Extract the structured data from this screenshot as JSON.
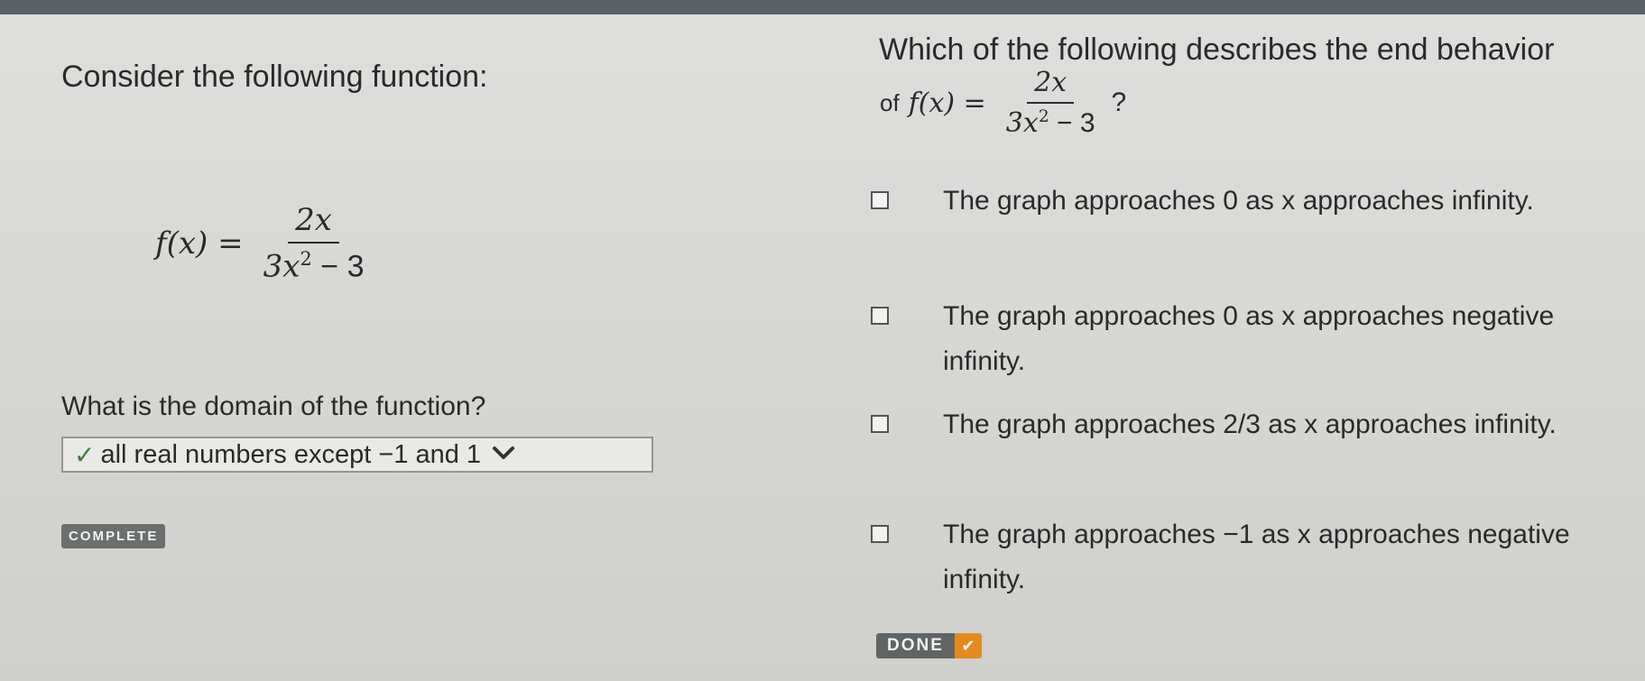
{
  "left": {
    "intro": "Consider the following function:",
    "formula": {
      "lhs": "f(x) =",
      "numerator": "2x",
      "den_base": "3x",
      "den_exp": "2",
      "den_rest": " − 3"
    },
    "domain_question": "What is the domain of the function?",
    "domain_answer": "all real numbers except −1 and 1",
    "complete_label": "COMPLETE"
  },
  "right": {
    "question_line1": "Which of the following describes the end behavior",
    "question_lead": "of",
    "formula": {
      "lhs": "f(x) =",
      "numerator": "2x",
      "den_base": "3x",
      "den_exp": "2",
      "den_rest": " − 3"
    },
    "question_mark": "?",
    "options": [
      {
        "text": "The graph approaches 0 as x approaches infinity."
      },
      {
        "text": "The graph approaches 0 as x approaches negative infinity."
      },
      {
        "text": "The graph approaches 2/3 as x approaches infinity."
      },
      {
        "text": "The graph approaches −1 as x approaches negative infinity."
      }
    ],
    "done_label": "DONE"
  },
  "icons": {
    "check": "✓",
    "chevron": "chevron-down-icon",
    "done_tick": "✔"
  },
  "colors": {
    "top_bar": "#5a6068",
    "check_green": "#3f7d3a",
    "done_accent": "#e58a1e",
    "badge_gray": "#6b6f6e"
  }
}
